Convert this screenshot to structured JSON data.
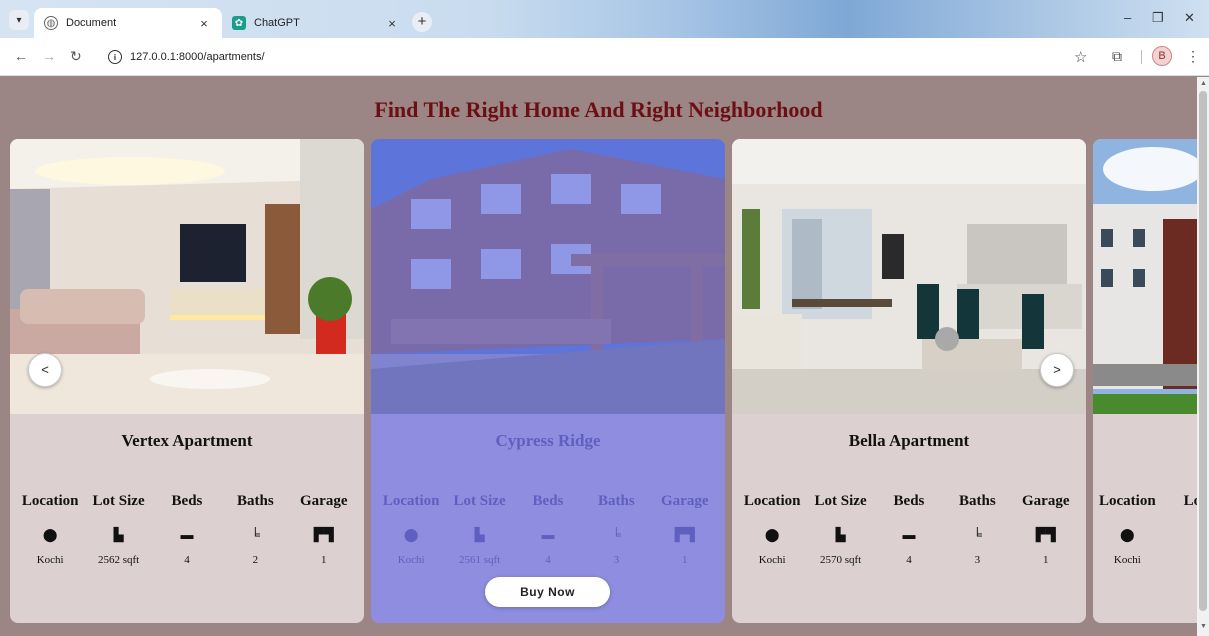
{
  "browser": {
    "tabs": [
      {
        "title": "Document",
        "active": true
      },
      {
        "title": "ChatGPT",
        "active": false
      }
    ],
    "url": "127.0.0.1:8000/apartments/",
    "new_tab_label": "+",
    "close_label": "×",
    "profile_initial": "B"
  },
  "page": {
    "heading": "Find The Right Home And Right Neighborhood",
    "prev_label": "<",
    "next_label": ">",
    "buy_now_label": "Buy Now",
    "columns": [
      "Location",
      "Lot Size",
      "Beds",
      "Baths",
      "Garage"
    ],
    "icons": [
      "map-pin-icon",
      "lot-size-icon",
      "bed-icon",
      "bath-icon",
      "garage-icon"
    ],
    "cards": [
      {
        "name": "Vertex Apartment",
        "values": [
          "Kochi",
          "2562 sqft",
          "4",
          "2",
          "1"
        ]
      },
      {
        "name": "Cypress Ridge",
        "values": [
          "Kochi",
          "2561 sqft",
          "4",
          "3",
          "1"
        ]
      },
      {
        "name": "Bella Apartment",
        "values": [
          "Kochi",
          "2570 sqft",
          "4",
          "3",
          "1"
        ]
      },
      {
        "name": "",
        "values": [
          "Kochi",
          "",
          "",
          "",
          ""
        ]
      }
    ]
  },
  "colors": {
    "page_bg": "#9c8585",
    "heading": "#6b0f14",
    "card_bg": "#ddd0d0",
    "hover_card_bg": "#8f8ddf",
    "hover_text": "#5e5fc0"
  }
}
